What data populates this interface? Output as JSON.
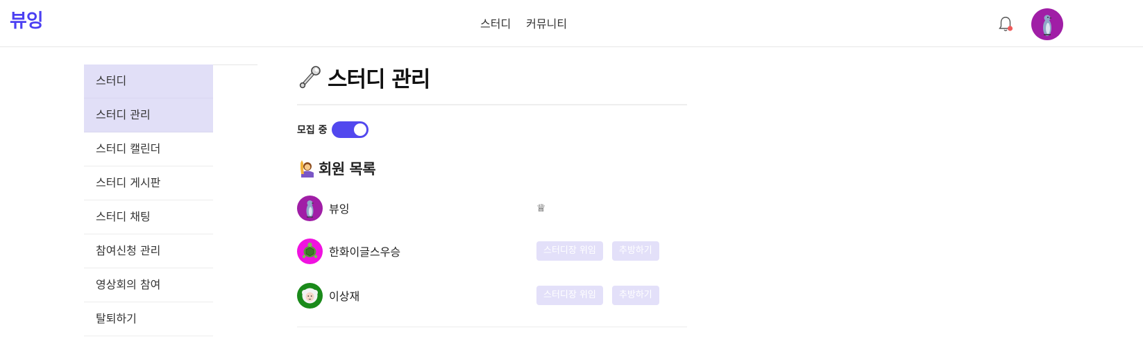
{
  "header": {
    "logo": "뷰잉",
    "nav": [
      "스터디",
      "커뮤니티"
    ],
    "accent_color": "#4b3ff2",
    "notification_dot_color": "#f05a5a"
  },
  "sidebar": {
    "items": [
      {
        "label": "스터디",
        "active": true
      },
      {
        "label": "스터디 관리",
        "active": true
      },
      {
        "label": "스터디 캘린더",
        "active": false
      },
      {
        "label": "스터디 게시판",
        "active": false
      },
      {
        "label": "스터디 채팅",
        "active": false
      },
      {
        "label": "참여신청 관리",
        "active": false
      },
      {
        "label": "영상회의 참여",
        "active": false
      },
      {
        "label": "탈퇴하기",
        "active": false
      }
    ],
    "active_color": "#e1dff7"
  },
  "main": {
    "title_icon": "wrench-icon",
    "title": "스터디 관리",
    "recruit_label": "모집 중",
    "recruit_on": true,
    "members_icon": "person-raising-hand-icon",
    "members_title": "회원 목록",
    "members": [
      {
        "name": "뷰잉",
        "avatar": "penguin-avatar",
        "avatar_color": "#a01ea6",
        "leader": true,
        "crown_icon": "♕"
      },
      {
        "name": "한화이글스우승",
        "avatar": "turtle-avatar",
        "avatar_color": "#f012e0",
        "leader": false,
        "delegate_label": "스터디장 위임",
        "kick_label": "추방하기"
      },
      {
        "name": "이상재",
        "avatar": "sheep-avatar",
        "avatar_color": "#1a8a1a",
        "leader": false,
        "delegate_label": "스터디장 위임",
        "kick_label": "추방하기"
      }
    ],
    "button_color": "#e3e0f9",
    "toggle_color": "#5248ee"
  }
}
